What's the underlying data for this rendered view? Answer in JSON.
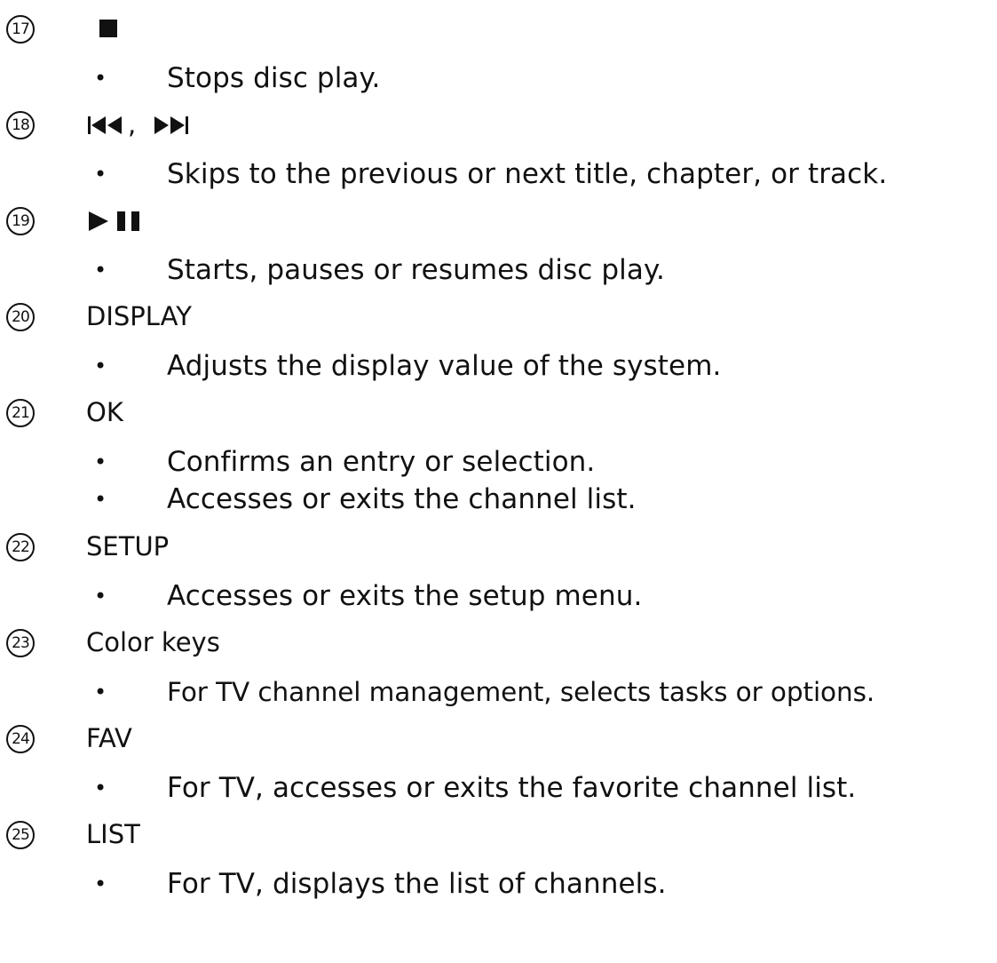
{
  "entries": [
    {
      "number": "17",
      "title": "",
      "icon": "stop-icon",
      "bullets": [
        "Stops disc play."
      ]
    },
    {
      "number": "18",
      "title": "",
      "icon": "previous-next-icon",
      "bullets": [
        "Skips to the previous or next title, chapter, or track."
      ]
    },
    {
      "number": "19",
      "title": "",
      "icon": "play-pause-icon",
      "bullets": [
        "Starts, pauses or resumes disc play."
      ]
    },
    {
      "number": "20",
      "title": "DISPLAY",
      "bullets": [
        "Adjusts the display value of the system."
      ]
    },
    {
      "number": "21",
      "title": "OK",
      "bullets": [
        "Confirms an entry or selection.",
        "Accesses or exits the channel list."
      ]
    },
    {
      "number": "22",
      "title": "SETUP",
      "bullets": [
        "Accesses or exits the setup menu."
      ]
    },
    {
      "number": "23",
      "title": "Color keys",
      "bullets": [
        "For TV channel management, selects tasks or options."
      ]
    },
    {
      "number": "24",
      "title": "FAV",
      "bullets": [
        "For TV, accesses or exits the favorite channel list."
      ]
    },
    {
      "number": "25",
      "title": "LIST",
      "bullets": [
        "For TV, displays the list of channels."
      ]
    }
  ],
  "bullet_char": "•",
  "separator_comma": ","
}
